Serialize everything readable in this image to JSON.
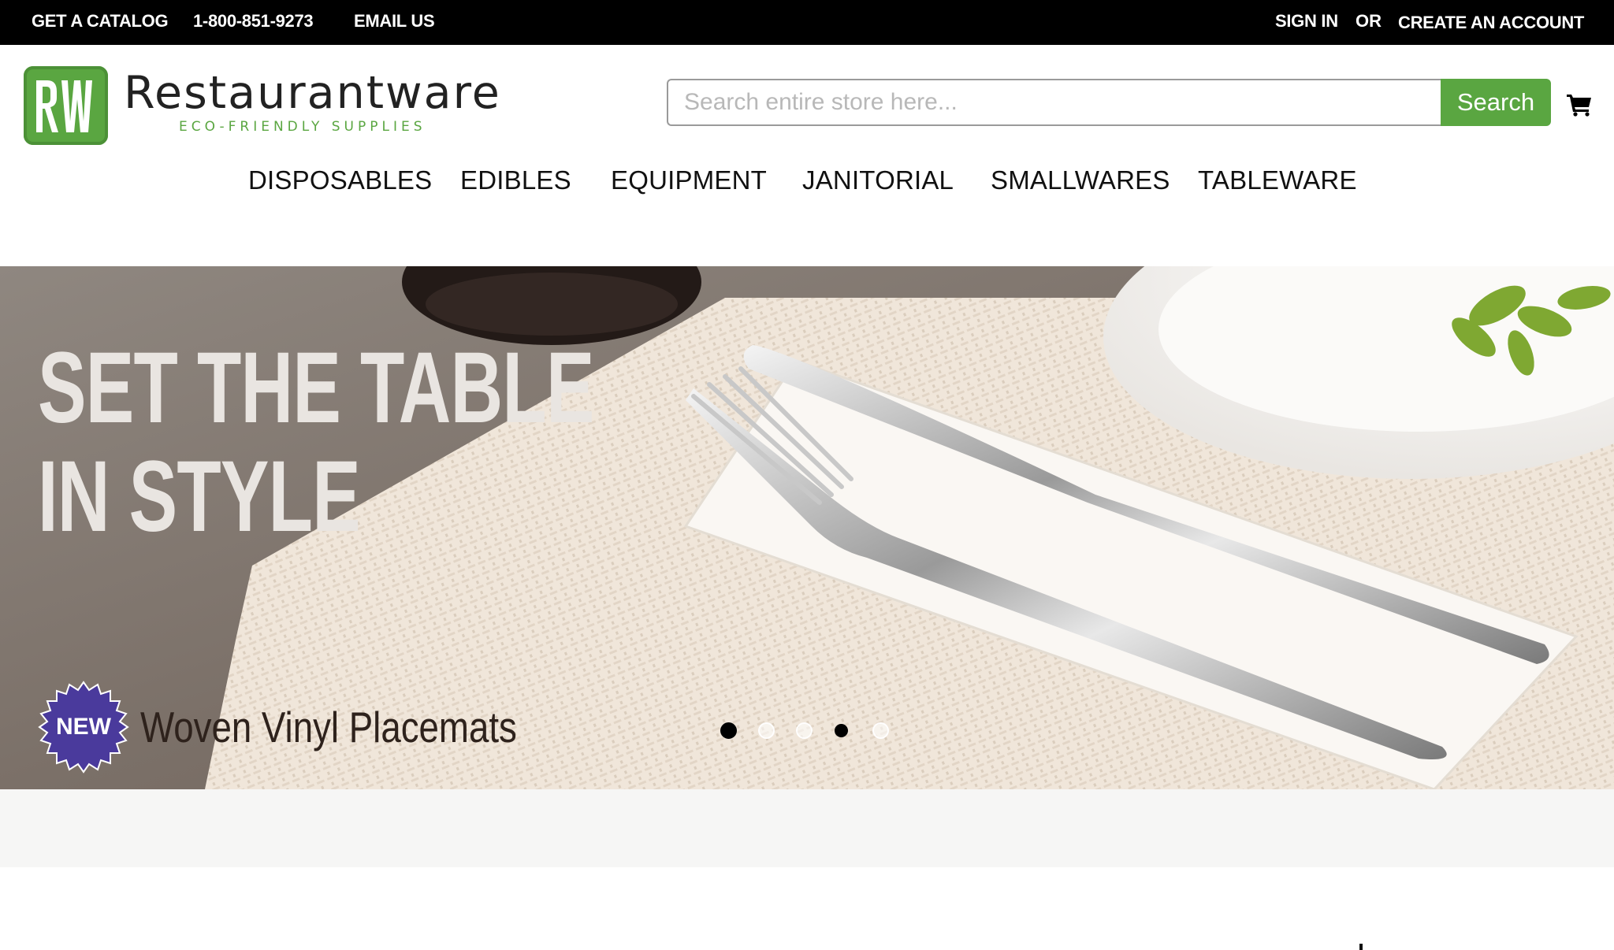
{
  "topbar": {
    "catalog": "GET A CATALOG",
    "phone": "1-800-851-9273",
    "email": "EMAIL US",
    "sign_in": "SIGN IN",
    "or": "OR",
    "create_account": "CREATE AN ACCOUNT"
  },
  "logo": {
    "mark": "RW",
    "name": "Restaurantware",
    "tagline": "ECO-FRIENDLY SUPPLIES",
    "brand_color": "#5aa641"
  },
  "search": {
    "placeholder": "Search entire store here...",
    "value": "",
    "button_label": "Search",
    "cart_icon": "shopping-cart-icon"
  },
  "nav": {
    "items": [
      {
        "label": "DISPOSABLES"
      },
      {
        "label": "EDIBLES"
      },
      {
        "label": "EQUIPMENT"
      },
      {
        "label": "JANITORIAL"
      },
      {
        "label": "SMALLWARES"
      },
      {
        "label": "TABLEWARE"
      }
    ]
  },
  "hero": {
    "heading_line1": "SET THE TABLE",
    "heading_line2": "IN STYLE",
    "badge": "NEW",
    "product": "Woven Vinyl Placemats",
    "slides": 5,
    "badge_color": "#4a3a9c"
  }
}
